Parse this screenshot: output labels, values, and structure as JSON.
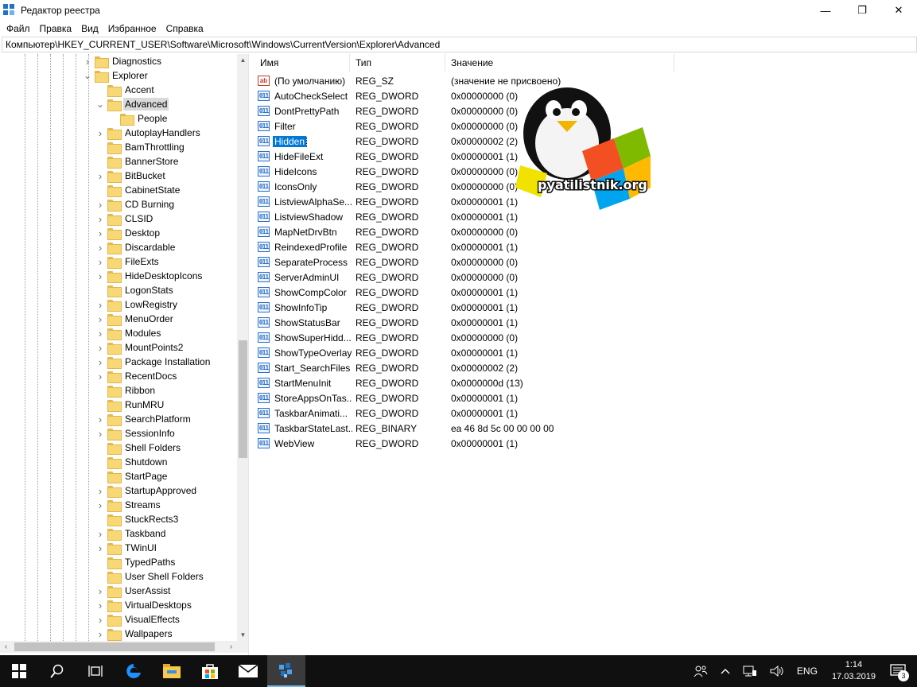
{
  "window": {
    "title": "Редактор реестра",
    "minimize_glyph": "—",
    "maximize_glyph": "❐",
    "close_glyph": "✕"
  },
  "menu": [
    "Файл",
    "Правка",
    "Вид",
    "Избранное",
    "Справка"
  ],
  "address": "Компьютер\\HKEY_CURRENT_USER\\Software\\Microsoft\\Windows\\CurrentVersion\\Explorer\\Advanced",
  "tree": {
    "items": [
      {
        "label": "Diagnostics",
        "level": 1,
        "chevron": "right",
        "selected": false
      },
      {
        "label": "Explorer",
        "level": 1,
        "chevron": "down",
        "selected": false
      },
      {
        "label": "Accent",
        "level": 2,
        "chevron": "none",
        "selected": false
      },
      {
        "label": "Advanced",
        "level": 2,
        "chevron": "down",
        "selected": true
      },
      {
        "label": "People",
        "level": 3,
        "chevron": "none",
        "selected": false
      },
      {
        "label": "AutoplayHandlers",
        "level": 2,
        "chevron": "right",
        "selected": false
      },
      {
        "label": "BamThrottling",
        "level": 2,
        "chevron": "none",
        "selected": false
      },
      {
        "label": "BannerStore",
        "level": 2,
        "chevron": "none",
        "selected": false
      },
      {
        "label": "BitBucket",
        "level": 2,
        "chevron": "right",
        "selected": false
      },
      {
        "label": "CabinetState",
        "level": 2,
        "chevron": "none",
        "selected": false
      },
      {
        "label": "CD Burning",
        "level": 2,
        "chevron": "right",
        "selected": false
      },
      {
        "label": "CLSID",
        "level": 2,
        "chevron": "right",
        "selected": false
      },
      {
        "label": "Desktop",
        "level": 2,
        "chevron": "right",
        "selected": false
      },
      {
        "label": "Discardable",
        "level": 2,
        "chevron": "right",
        "selected": false
      },
      {
        "label": "FileExts",
        "level": 2,
        "chevron": "right",
        "selected": false
      },
      {
        "label": "HideDesktopIcons",
        "level": 2,
        "chevron": "right",
        "selected": false
      },
      {
        "label": "LogonStats",
        "level": 2,
        "chevron": "none",
        "selected": false
      },
      {
        "label": "LowRegistry",
        "level": 2,
        "chevron": "right",
        "selected": false
      },
      {
        "label": "MenuOrder",
        "level": 2,
        "chevron": "right",
        "selected": false
      },
      {
        "label": "Modules",
        "level": 2,
        "chevron": "right",
        "selected": false
      },
      {
        "label": "MountPoints2",
        "level": 2,
        "chevron": "right",
        "selected": false
      },
      {
        "label": "Package Installation",
        "level": 2,
        "chevron": "right",
        "selected": false
      },
      {
        "label": "RecentDocs",
        "level": 2,
        "chevron": "right",
        "selected": false
      },
      {
        "label": "Ribbon",
        "level": 2,
        "chevron": "none",
        "selected": false
      },
      {
        "label": "RunMRU",
        "level": 2,
        "chevron": "none",
        "selected": false
      },
      {
        "label": "SearchPlatform",
        "level": 2,
        "chevron": "right",
        "selected": false
      },
      {
        "label": "SessionInfo",
        "level": 2,
        "chevron": "right",
        "selected": false
      },
      {
        "label": "Shell Folders",
        "level": 2,
        "chevron": "none",
        "selected": false
      },
      {
        "label": "Shutdown",
        "level": 2,
        "chevron": "none",
        "selected": false
      },
      {
        "label": "StartPage",
        "level": 2,
        "chevron": "none",
        "selected": false
      },
      {
        "label": "StartupApproved",
        "level": 2,
        "chevron": "right",
        "selected": false
      },
      {
        "label": "Streams",
        "level": 2,
        "chevron": "right",
        "selected": false
      },
      {
        "label": "StuckRects3",
        "level": 2,
        "chevron": "none",
        "selected": false
      },
      {
        "label": "Taskband",
        "level": 2,
        "chevron": "right",
        "selected": false
      },
      {
        "label": "TWinUI",
        "level": 2,
        "chevron": "right",
        "selected": false
      },
      {
        "label": "TypedPaths",
        "level": 2,
        "chevron": "none",
        "selected": false
      },
      {
        "label": "User Shell Folders",
        "level": 2,
        "chevron": "none",
        "selected": false
      },
      {
        "label": "UserAssist",
        "level": 2,
        "chevron": "right",
        "selected": false
      },
      {
        "label": "VirtualDesktops",
        "level": 2,
        "chevron": "right",
        "selected": false
      },
      {
        "label": "VisualEffects",
        "level": 2,
        "chevron": "right",
        "selected": false
      },
      {
        "label": "Wallpapers",
        "level": 2,
        "chevron": "right",
        "selected": false
      }
    ]
  },
  "list": {
    "columns": [
      "Имя",
      "Тип",
      "Значение"
    ],
    "rows": [
      {
        "name": "(По умолчанию)",
        "type": "REG_SZ",
        "data": "(значение не присвоено)",
        "icon": "string-value-icon",
        "selected": false
      },
      {
        "name": "AutoCheckSelect",
        "type": "REG_DWORD",
        "data": "0x00000000 (0)",
        "icon": "binary-value-icon",
        "selected": false
      },
      {
        "name": "DontPrettyPath",
        "type": "REG_DWORD",
        "data": "0x00000000 (0)",
        "icon": "binary-value-icon",
        "selected": false
      },
      {
        "name": "Filter",
        "type": "REG_DWORD",
        "data": "0x00000000 (0)",
        "icon": "binary-value-icon",
        "selected": false
      },
      {
        "name": "Hidden",
        "type": "REG_DWORD",
        "data": "0x00000002 (2)",
        "icon": "binary-value-icon",
        "selected": true
      },
      {
        "name": "HideFileExt",
        "type": "REG_DWORD",
        "data": "0x00000001 (1)",
        "icon": "binary-value-icon",
        "selected": false
      },
      {
        "name": "HideIcons",
        "type": "REG_DWORD",
        "data": "0x00000000 (0)",
        "icon": "binary-value-icon",
        "selected": false
      },
      {
        "name": "IconsOnly",
        "type": "REG_DWORD",
        "data": "0x00000000 (0)",
        "icon": "binary-value-icon",
        "selected": false
      },
      {
        "name": "ListviewAlphaSe...",
        "type": "REG_DWORD",
        "data": "0x00000001 (1)",
        "icon": "binary-value-icon",
        "selected": false
      },
      {
        "name": "ListviewShadow",
        "type": "REG_DWORD",
        "data": "0x00000001 (1)",
        "icon": "binary-value-icon",
        "selected": false
      },
      {
        "name": "MapNetDrvBtn",
        "type": "REG_DWORD",
        "data": "0x00000000 (0)",
        "icon": "binary-value-icon",
        "selected": false
      },
      {
        "name": "ReindexedProfile",
        "type": "REG_DWORD",
        "data": "0x00000001 (1)",
        "icon": "binary-value-icon",
        "selected": false
      },
      {
        "name": "SeparateProcess",
        "type": "REG_DWORD",
        "data": "0x00000000 (0)",
        "icon": "binary-value-icon",
        "selected": false
      },
      {
        "name": "ServerAdminUI",
        "type": "REG_DWORD",
        "data": "0x00000000 (0)",
        "icon": "binary-value-icon",
        "selected": false
      },
      {
        "name": "ShowCompColor",
        "type": "REG_DWORD",
        "data": "0x00000001 (1)",
        "icon": "binary-value-icon",
        "selected": false
      },
      {
        "name": "ShowInfoTip",
        "type": "REG_DWORD",
        "data": "0x00000001 (1)",
        "icon": "binary-value-icon",
        "selected": false
      },
      {
        "name": "ShowStatusBar",
        "type": "REG_DWORD",
        "data": "0x00000001 (1)",
        "icon": "binary-value-icon",
        "selected": false
      },
      {
        "name": "ShowSuperHidd...",
        "type": "REG_DWORD",
        "data": "0x00000000 (0)",
        "icon": "binary-value-icon",
        "selected": false
      },
      {
        "name": "ShowTypeOverlay",
        "type": "REG_DWORD",
        "data": "0x00000001 (1)",
        "icon": "binary-value-icon",
        "selected": false
      },
      {
        "name": "Start_SearchFiles",
        "type": "REG_DWORD",
        "data": "0x00000002 (2)",
        "icon": "binary-value-icon",
        "selected": false
      },
      {
        "name": "StartMenuInit",
        "type": "REG_DWORD",
        "data": "0x0000000d (13)",
        "icon": "binary-value-icon",
        "selected": false
      },
      {
        "name": "StoreAppsOnTas...",
        "type": "REG_DWORD",
        "data": "0x00000001 (1)",
        "icon": "binary-value-icon",
        "selected": false
      },
      {
        "name": "TaskbarAnimati...",
        "type": "REG_DWORD",
        "data": "0x00000001 (1)",
        "icon": "binary-value-icon",
        "selected": false
      },
      {
        "name": "TaskbarStateLast...",
        "type": "REG_BINARY",
        "data": "ea 46 8d 5c 00 00 00 00",
        "icon": "binary-value-icon",
        "selected": false
      },
      {
        "name": "WebView",
        "type": "REG_DWORD",
        "data": "0x00000001 (1)",
        "icon": "binary-value-icon",
        "selected": false
      }
    ]
  },
  "icon_glyphs": {
    "string": "ab",
    "binary": "011"
  },
  "watermark": {
    "text": "pyatilistnik.org"
  },
  "taskbar": {
    "buttons": [
      {
        "name": "start-button",
        "icon": "windows-logo-icon"
      },
      {
        "name": "search-button",
        "icon": "search-icon"
      },
      {
        "name": "task-view-button",
        "icon": "task-view-icon"
      },
      {
        "name": "edge-button",
        "icon": "edge-icon"
      },
      {
        "name": "file-explorer-button",
        "icon": "folder-icon"
      },
      {
        "name": "store-button",
        "icon": "store-icon"
      },
      {
        "name": "mail-button",
        "icon": "mail-icon"
      },
      {
        "name": "regedit-button",
        "icon": "regedit-icon"
      }
    ],
    "language": "ENG",
    "time": "1:14",
    "date": "17.03.2019",
    "notification_count": "3"
  },
  "colors": {
    "selection": "#0078d7",
    "tree_selected": "#d9d9d9",
    "taskbar": "#101010",
    "folder": "#f8d775"
  }
}
